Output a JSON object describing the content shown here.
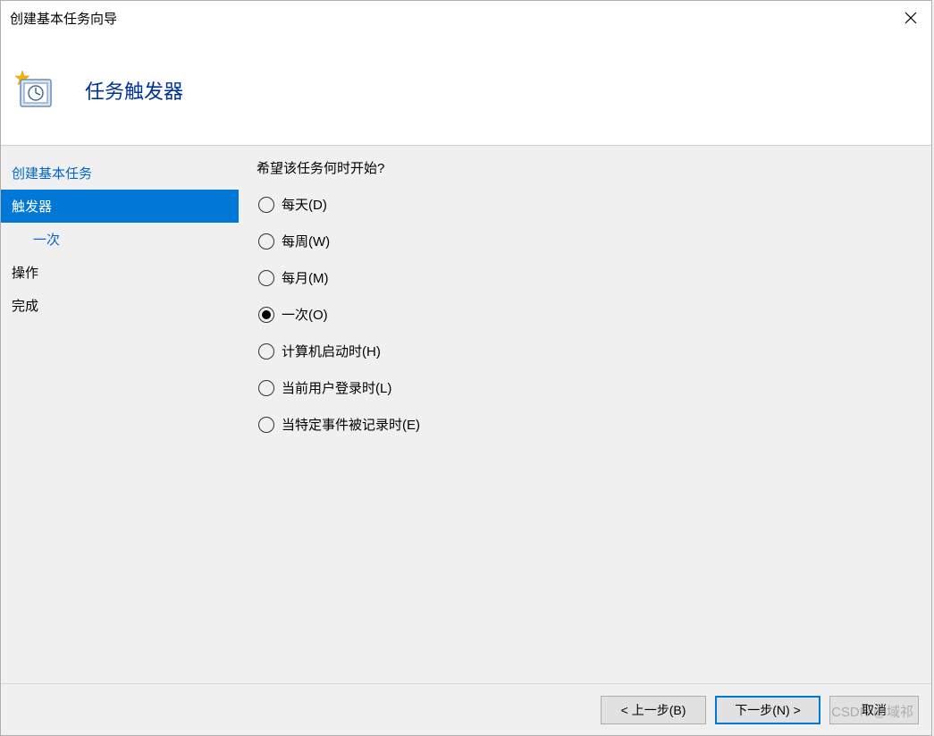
{
  "titlebar": {
    "title": "创建基本任务向导"
  },
  "header": {
    "title": "任务触发器"
  },
  "sidebar": {
    "items": [
      {
        "label": "创建基本任务",
        "active": false,
        "indent": false,
        "link": true
      },
      {
        "label": "触发器",
        "active": true,
        "indent": false,
        "link": false
      },
      {
        "label": "一次",
        "active": false,
        "indent": true,
        "link": true
      },
      {
        "label": "操作",
        "active": false,
        "indent": false,
        "link": false
      },
      {
        "label": "完成",
        "active": false,
        "indent": false,
        "link": false
      }
    ]
  },
  "content": {
    "prompt": "希望该任务何时开始?",
    "options": [
      {
        "label": "每天(D)",
        "selected": false
      },
      {
        "label": "每周(W)",
        "selected": false
      },
      {
        "label": "每月(M)",
        "selected": false
      },
      {
        "label": "一次(O)",
        "selected": true
      },
      {
        "label": "计算机启动时(H)",
        "selected": false
      },
      {
        "label": "当前用户登录时(L)",
        "selected": false
      },
      {
        "label": "当特定事件被记录时(E)",
        "selected": false
      }
    ]
  },
  "footer": {
    "back": "< 上一步(B)",
    "next": "下一步(N) >",
    "cancel": "取消"
  },
  "watermark": "CSDN @域祁"
}
